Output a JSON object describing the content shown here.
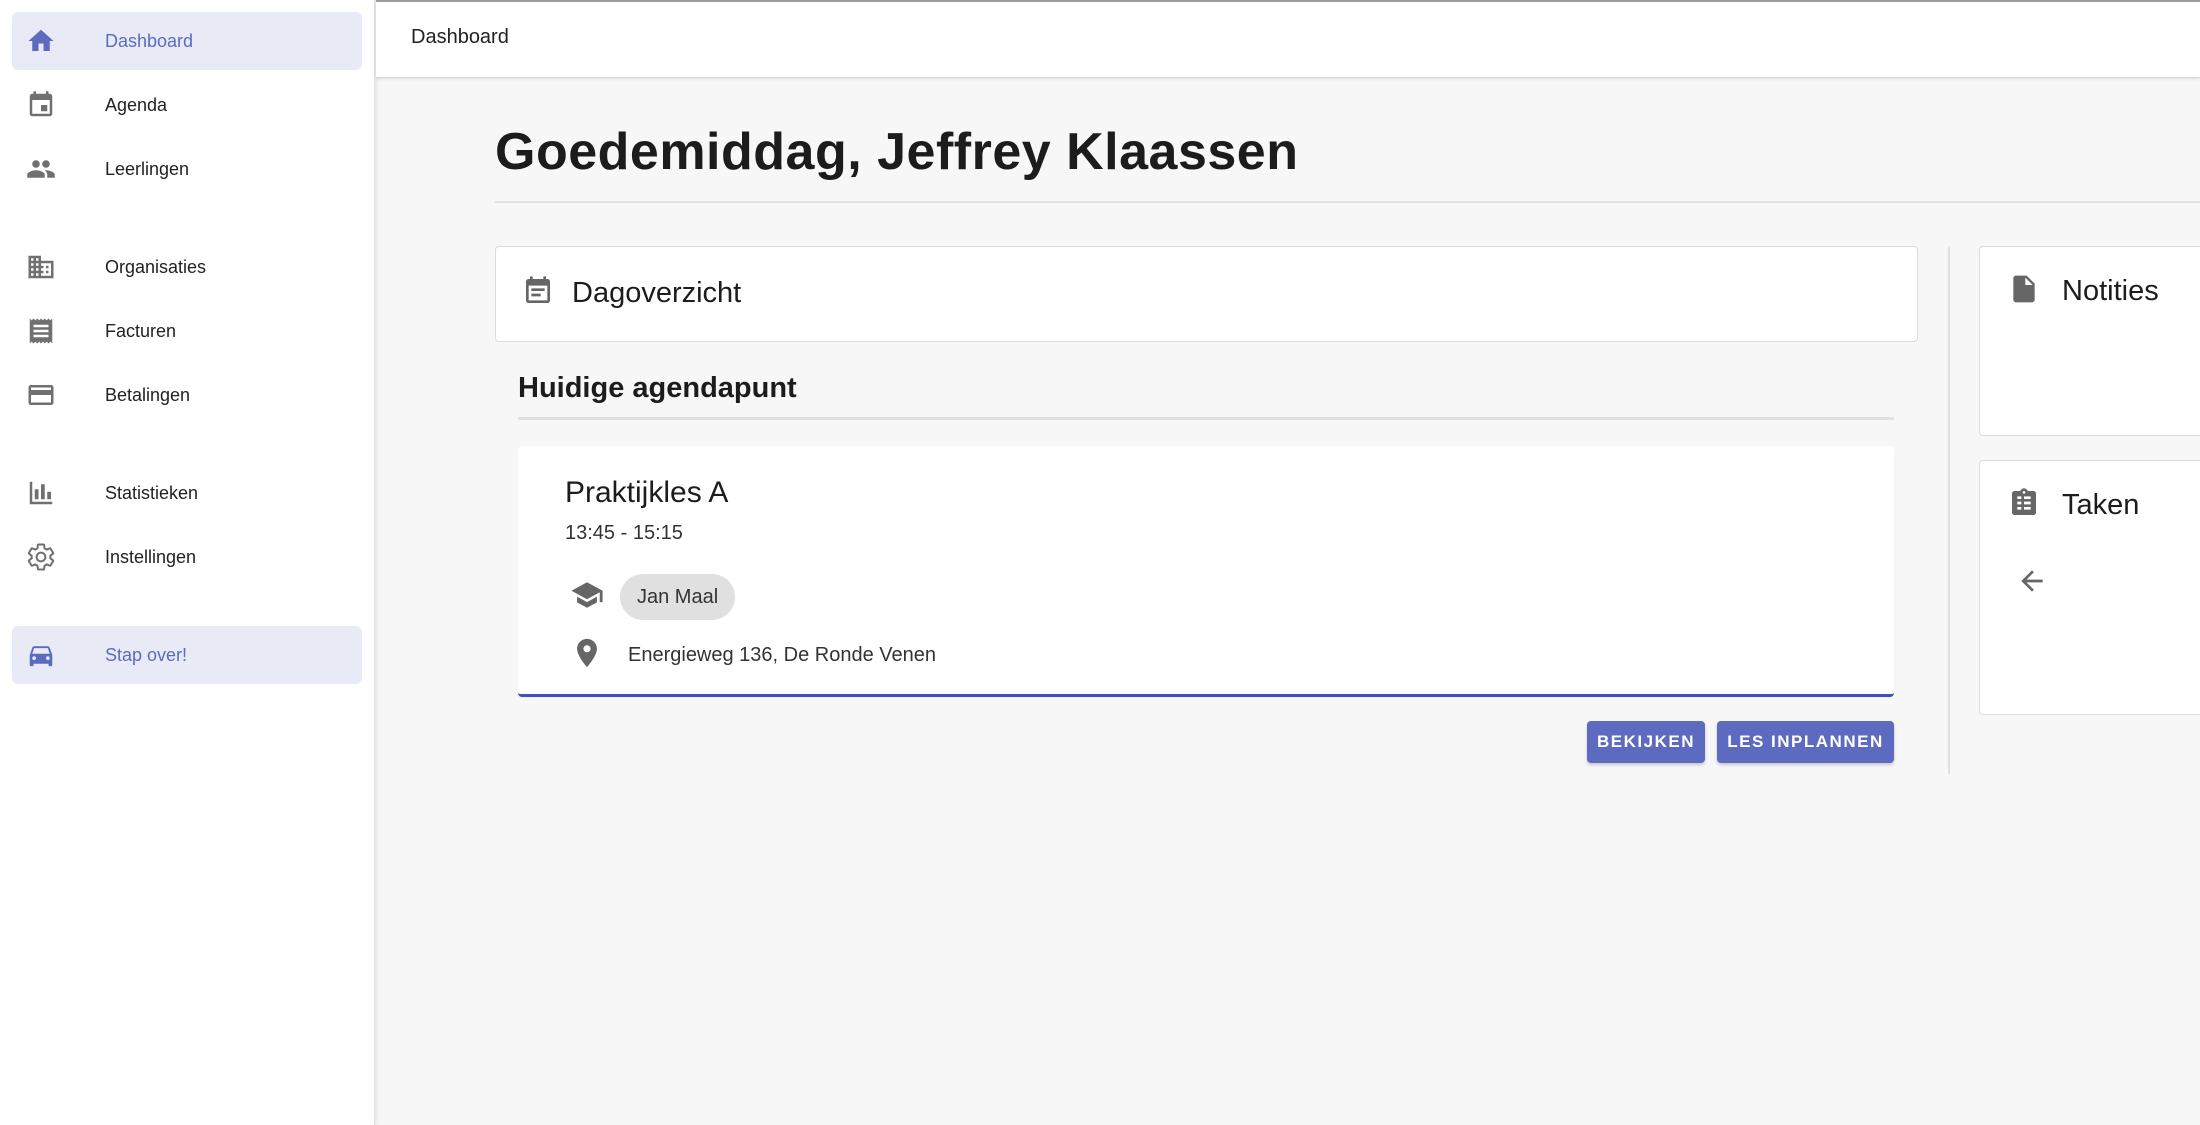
{
  "sidebar": {
    "items": [
      {
        "label": "Dashboard",
        "icon": "home-icon",
        "active": true
      },
      {
        "label": "Agenda",
        "icon": "calendar-icon"
      },
      {
        "label": "Leerlingen",
        "icon": "people-icon"
      },
      {
        "label": "Organisaties",
        "icon": "building-icon"
      },
      {
        "label": "Facturen",
        "icon": "receipt-icon"
      },
      {
        "label": "Betalingen",
        "icon": "credit-card-icon"
      },
      {
        "label": "Statistieken",
        "icon": "bar-chart-icon"
      },
      {
        "label": "Instellingen",
        "icon": "gear-icon"
      },
      {
        "label": "Stap over!",
        "icon": "car-icon",
        "active": true
      }
    ]
  },
  "topbar": {
    "breadcrumb": "Dashboard"
  },
  "main": {
    "greeting": "Goedemiddag, Jeffrey Klaassen",
    "day_overview": {
      "title": "Dagoverzicht"
    },
    "current_item": {
      "section_title": "Huidige agendapunt",
      "event_title": "Praktijkles A",
      "time": "13:45 - 15:15",
      "student": "Jan Maal",
      "location": "Energieweg 136, De Ronde Venen"
    },
    "actions": {
      "view": "BEKIJKEN",
      "plan": "LES INPLANNEN"
    }
  },
  "side_panels": {
    "notes": {
      "title": "Notities"
    },
    "tasks": {
      "title": "Taken"
    }
  },
  "colors": {
    "accent": "#5c6bc0",
    "active_bg": "#e8eaf6",
    "indicator": "#3f51b5"
  }
}
